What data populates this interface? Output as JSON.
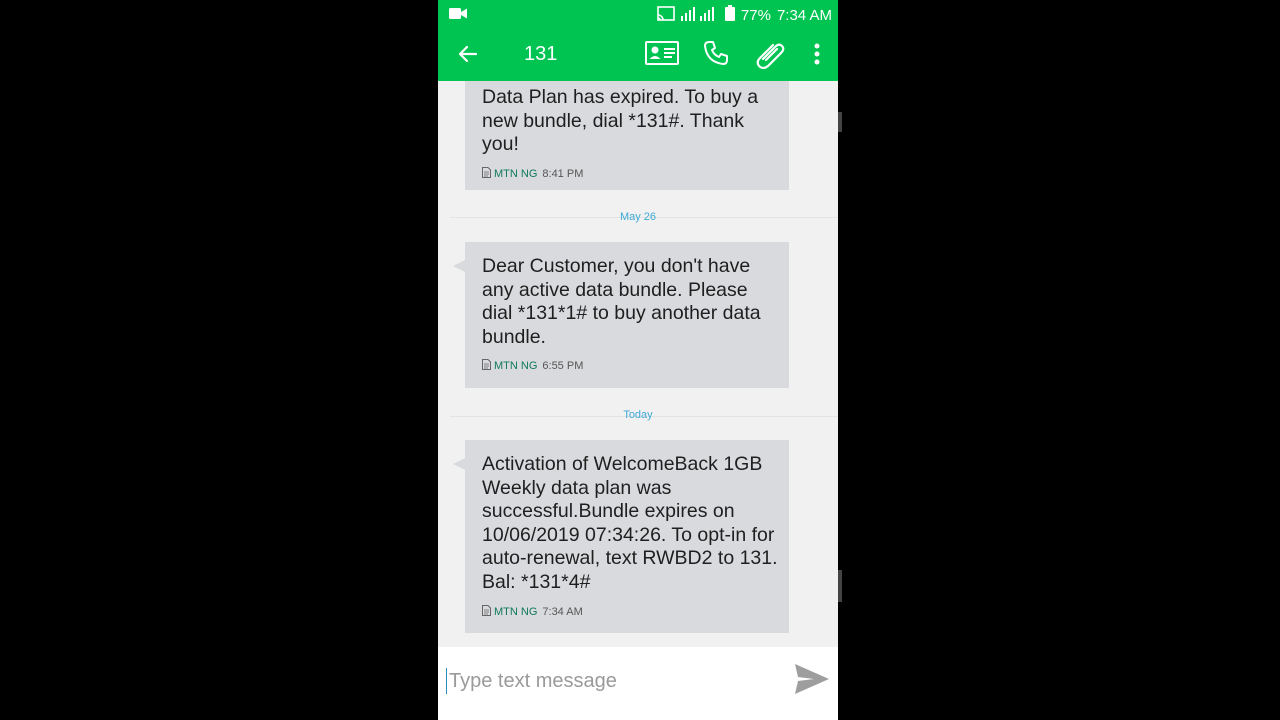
{
  "status_bar": {
    "battery": "77%",
    "time": "7:34 AM"
  },
  "app_bar": {
    "title": "131"
  },
  "thread": {
    "messages": [
      {
        "text": "Data Plan has expired. To buy a new bundle, dial *131#. Thank you!",
        "sim": "MTN NG",
        "time": "8:41 PM"
      },
      {
        "text": "Dear Customer, you don't have any active data bundle. Please dial *131*1# to buy another data bundle.",
        "sim": "MTN NG",
        "time": "6:55 PM"
      },
      {
        "text": "Activation of WelcomeBack 1GB Weekly data plan was successful.Bundle expires on 10/06/2019 07:34:26. To opt-in for auto-renewal, text RWBD2 to 131. Bal: *131*4#",
        "sim": "MTN NG",
        "time": "7:34 AM"
      }
    ],
    "date_separators": [
      "May 26",
      "Today"
    ]
  },
  "composer": {
    "placeholder": "Type text message"
  },
  "colors": {
    "accent": "#00c451",
    "bubble": "#d9dadd",
    "date_label": "#3fa9d6",
    "sim_label": "#0f7a5a"
  },
  "icons": [
    "video-camera-icon",
    "cast-icon",
    "signal-icon",
    "battery-icon",
    "back-arrow-icon",
    "contact-card-icon",
    "phone-icon",
    "paperclip-icon",
    "more-vert-icon",
    "sim-doc-icon",
    "send-icon"
  ]
}
